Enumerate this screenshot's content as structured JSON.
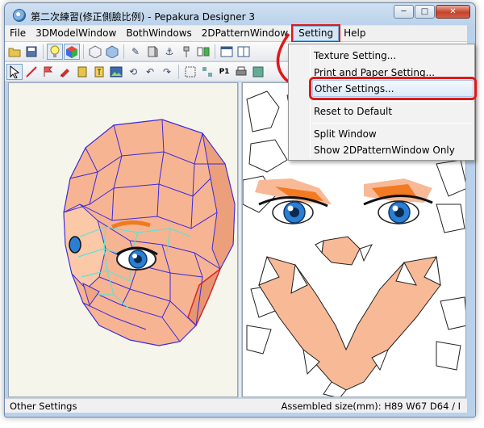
{
  "window": {
    "title": "第二次練習(修正側臉比例) - Pepakura Designer 3",
    "controls": {
      "minimize": "─",
      "maximize": "□",
      "close": "✕"
    }
  },
  "menubar": {
    "items": [
      {
        "label": "File"
      },
      {
        "label": "3DModelWindow"
      },
      {
        "label": "BothWindows"
      },
      {
        "label": "2DPatternWindow"
      },
      {
        "label": "Setting"
      },
      {
        "label": "Help"
      }
    ]
  },
  "setting_menu": {
    "items": [
      {
        "label": "Texture Setting..."
      },
      {
        "label": "Print and Paper Setting..."
      },
      {
        "label": "Other Settings..."
      },
      {
        "label": "Reset to Default"
      },
      {
        "label": "Split Window"
      },
      {
        "label": "Show 2DPatternWindow Only"
      }
    ]
  },
  "toolbar": {
    "row1_icons": [
      "open-icon",
      "save-icon",
      "bulb-icon",
      "cube-color-icon",
      "cube-wire-icon",
      "cube-icon",
      "pencil-icon",
      "pushpin-icon",
      "anchor-icon",
      "fold-icon",
      "unfold-icon",
      "window-single-icon",
      "window-dual-icon"
    ],
    "row2_icons": [
      "select-icon",
      "edge-icon",
      "flag-icon",
      "paint-icon",
      "join-icon",
      "text-icon",
      "image-icon",
      "rotate-icon",
      "undo-icon",
      "redo-icon",
      "frame-icon",
      "layout-icon",
      "page-icon",
      "print-icon"
    ],
    "p1_label": "P1"
  },
  "status": {
    "left": "Other Settings",
    "right": "Assembled size(mm): H89 W67 D64 / I"
  },
  "colors": {
    "highlight_red": "#e01818",
    "skin": "#f9b996",
    "wire": "#3c2ad8",
    "teal": "#5fe3d2",
    "eye_blue": "#2a7fd4"
  }
}
